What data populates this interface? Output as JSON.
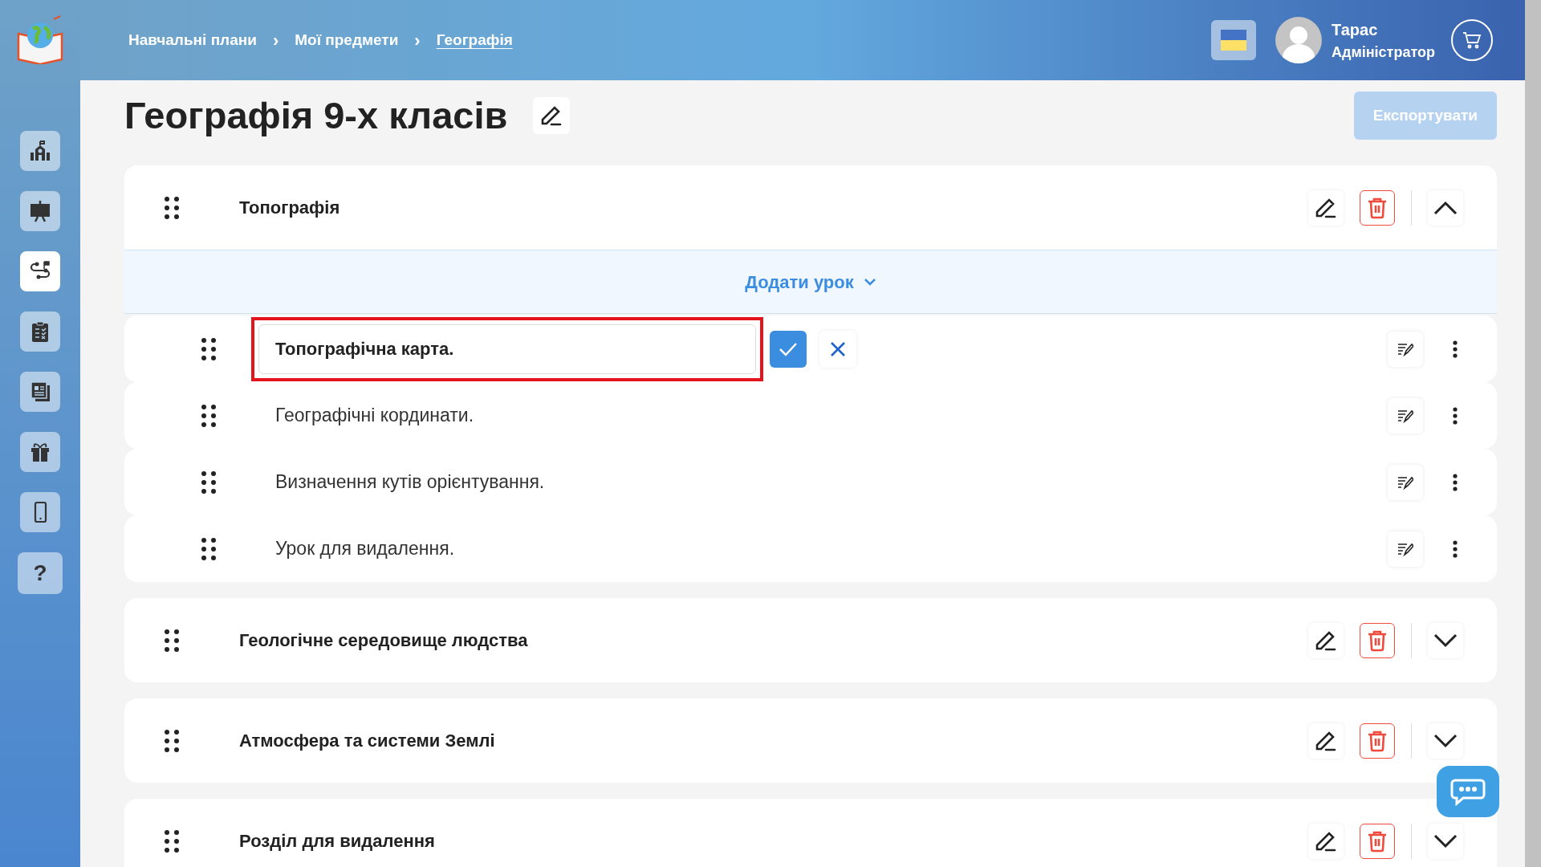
{
  "sidebar": {
    "items": [
      {
        "selected": false
      },
      {
        "selected": false
      },
      {
        "selected": true
      },
      {
        "selected": false
      },
      {
        "selected": false
      },
      {
        "selected": false
      },
      {
        "selected": false
      },
      {
        "label": "?",
        "selected": false
      }
    ]
  },
  "breadcrumbs": [
    {
      "label": "Навчальні плани",
      "current": false
    },
    {
      "label": "Мої предмети",
      "current": false
    },
    {
      "label": "Географія",
      "current": true
    }
  ],
  "breadcrumb_separator": "›",
  "user": {
    "name": "Тарас",
    "role": "Адміністратор"
  },
  "page_title": "Географія 9-х класів",
  "export_button": {
    "label": "Експортувати",
    "disabled": true
  },
  "sections": [
    {
      "title": "Топографія",
      "expanded": true,
      "add_lesson": "Додати урок",
      "lessons": [
        {
          "title": "Топографічна карта.",
          "editing": true
        },
        {
          "title": "Географічні кординати.",
          "editing": false
        },
        {
          "title": "Визначення кутів орієнтування.",
          "editing": false
        },
        {
          "title": "Урок для видалення.",
          "editing": false
        }
      ]
    },
    {
      "title": "Геологічне середовище людства",
      "expanded": false
    },
    {
      "title": "Атмосфера та системи Землі",
      "expanded": false
    },
    {
      "title": "Розділ для видалення",
      "expanded": false
    }
  ]
}
